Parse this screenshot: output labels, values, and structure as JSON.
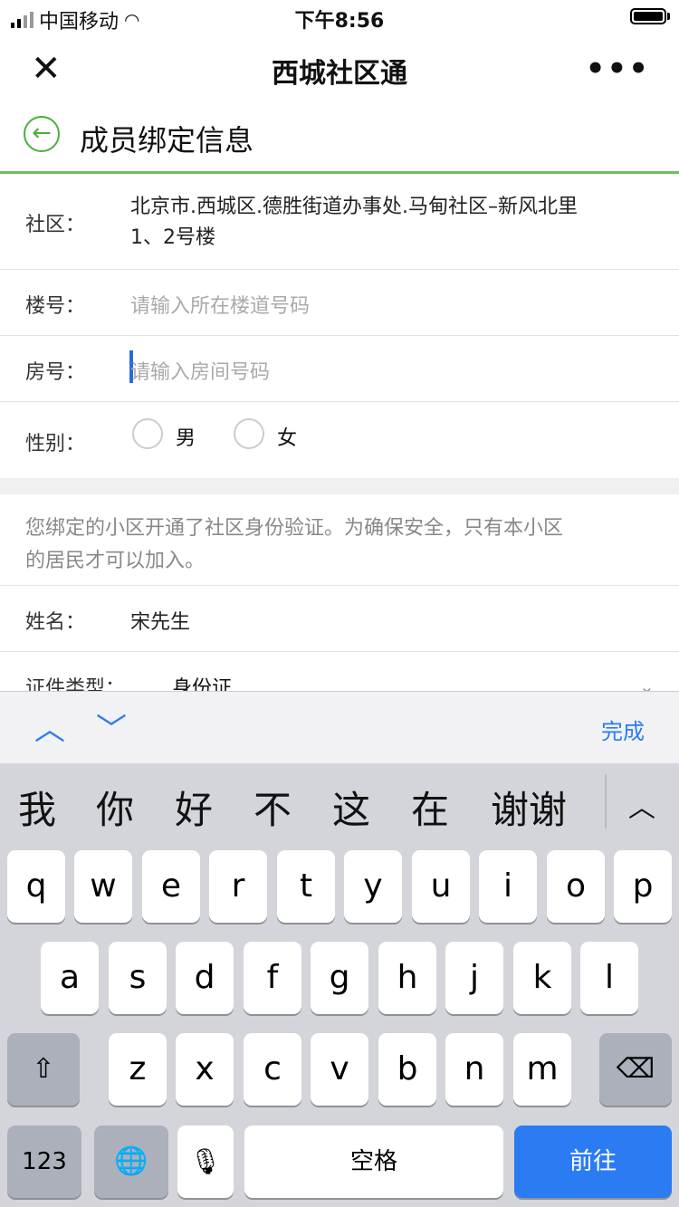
{
  "status": {
    "carrier": "中国移动",
    "time": "下午8:56"
  },
  "nav": {
    "title": "西城社区通",
    "close": "✕",
    "more": "•••"
  },
  "header": {
    "title": "成员绑定信息"
  },
  "form": {
    "community_label": "社区：",
    "community_line1": "北京市.西城区.德胜街道办事处.马甸社区–新风北里",
    "community_line2": "1、2号楼",
    "building_label": "楼号：",
    "building_placeholder": "请输入所在楼道号码",
    "room_label": "房号：",
    "room_placeholder": "请输入房间号码",
    "gender_label": "性别：",
    "gender_male": "男",
    "gender_female": "女"
  },
  "notice": {
    "line1": "您绑定的小区开通了社区身份验证。为确保安全，只有本小区",
    "line2": "的居民才可以加入。"
  },
  "member": {
    "name_label": "姓名：",
    "name_value": "宋先生",
    "id_label": "证件类型：",
    "id_value": "身份证"
  },
  "keyboard": {
    "done": "完成",
    "candidates": [
      "我",
      "你",
      "好",
      "不",
      "这",
      "在",
      "谢谢"
    ],
    "row1": [
      "q",
      "w",
      "e",
      "r",
      "t",
      "y",
      "u",
      "i",
      "o",
      "p"
    ],
    "row2": [
      "a",
      "s",
      "d",
      "f",
      "g",
      "h",
      "j",
      "k",
      "l"
    ],
    "row3": [
      "z",
      "x",
      "c",
      "v",
      "b",
      "n",
      "m"
    ],
    "num": "123",
    "space": "空格",
    "go": "前往"
  },
  "colors": {
    "accent_green": "#4cae3e",
    "ios_blue": "#2b7bf3",
    "keyboard_bg": "#d3d5db"
  }
}
